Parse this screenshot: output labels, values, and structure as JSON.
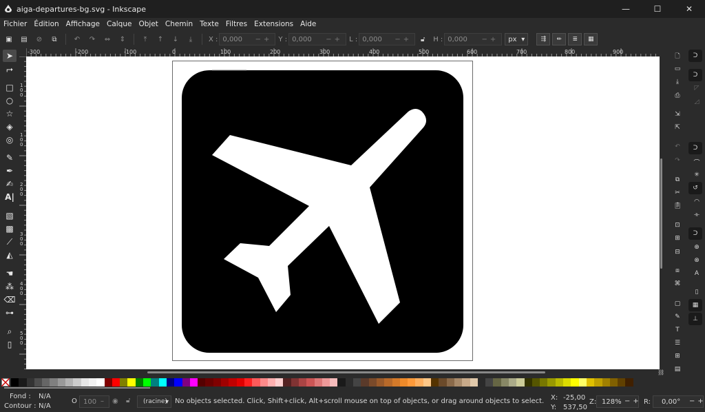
{
  "window": {
    "title": "aiga-departures-bg.svg - Inkscape",
    "controls": {
      "minimize": "—",
      "maximize": "☐",
      "close": "✕"
    }
  },
  "menu": [
    "Fichier",
    "Édition",
    "Affichage",
    "Calque",
    "Objet",
    "Chemin",
    "Texte",
    "Filtres",
    "Extensions",
    "Aide"
  ],
  "tool_controls": {
    "x_label": "X :",
    "x_value": "0,000",
    "y_label": "Y :",
    "y_value": "0,000",
    "w_label": "L :",
    "w_value": "0,000",
    "h_label": "H :",
    "h_value": "0,000",
    "unit": "px"
  },
  "ruler": {
    "h_labels": [
      "-300",
      "-200",
      "-100",
      "0",
      "100",
      "200",
      "300",
      "400",
      "500",
      "600",
      "700",
      "800",
      "900"
    ],
    "v_labels": [
      "1",
      "0",
      "0",
      "1",
      "0",
      "0",
      "2",
      "0",
      "0",
      "3",
      "0",
      "0",
      "4",
      "0",
      "0",
      "5",
      "0",
      "0"
    ]
  },
  "icons": {
    "tools": [
      "selector-icon",
      "node-icon",
      "rect-icon",
      "ellipse-icon",
      "star-icon",
      "box3d-icon",
      "spiral-icon",
      "pencil-icon",
      "pen-icon",
      "calligraphy-icon",
      "text-icon",
      "gradient-icon",
      "mesh-icon",
      "dropper-icon",
      "bucket-icon",
      "tweak-icon",
      "spray-icon",
      "eraser-icon",
      "connector-icon",
      "zoom-icon",
      "measure-icon"
    ]
  },
  "palette_colors": [
    "#000000",
    "#1a1a1a",
    "#333333",
    "#4d4d4d",
    "#666666",
    "#808080",
    "#999999",
    "#b3b3b3",
    "#cccccc",
    "#e6e6e6",
    "#f2f2f2",
    "#ffffff",
    "#800000",
    "#ff0000",
    "#808000",
    "#ffff00",
    "#008000",
    "#00ff00",
    "#008080",
    "#00ffff",
    "#000080",
    "#0000ff",
    "#800080",
    "#ff00ff",
    "#550000",
    "#6b0000",
    "#800000",
    "#a00000",
    "#c00000",
    "#e00000",
    "#ff2020",
    "#ff5a5a",
    "#ff8a8a",
    "#ffb0b0",
    "#ffd0d0",
    "#552222",
    "#803333",
    "#aa4444",
    "#cc5555",
    "#dd7777",
    "#ee9999",
    "#f5bbbb",
    "#1a1a1a",
    "#2d2d2d",
    "#444444",
    "#5a3a2a",
    "#7a4a2a",
    "#9a5a2a",
    "#b86a2a",
    "#d47a2a",
    "#ee8a2a",
    "#ff9a3a",
    "#ffb060",
    "#ffc888",
    "#553300",
    "#6b4a2a",
    "#8a6a4a",
    "#a88a6a",
    "#c8aa8a",
    "#e0c8aa",
    "#2a2a2a",
    "#444444",
    "#666644",
    "#888866",
    "#aaaa88",
    "#cccc99",
    "#333300",
    "#555500",
    "#777700",
    "#999900",
    "#bbbb00",
    "#dddd00",
    "#ffff00",
    "#ffff66",
    "#e0c000",
    "#c0a000",
    "#a08000",
    "#806000",
    "#604000",
    "#402000"
  ],
  "status": {
    "fill_label": "Fond :",
    "fill_value": "N/A",
    "stroke_label": "Contour :",
    "stroke_value": "N/A",
    "opacity_label": "O :",
    "opacity_value": "100",
    "layer": "(racine)",
    "message": "No objects selected. Click, Shift+click, Alt+scroll mouse on top of objects, or drag around objects to select.",
    "x_label": "X:",
    "x_value": "-25,00",
    "y_label": "Y:",
    "y_value": "537,50",
    "zoom_label": "Z:",
    "zoom_value": "128%",
    "rot_label": "R:",
    "rot_value": "0,00°"
  }
}
